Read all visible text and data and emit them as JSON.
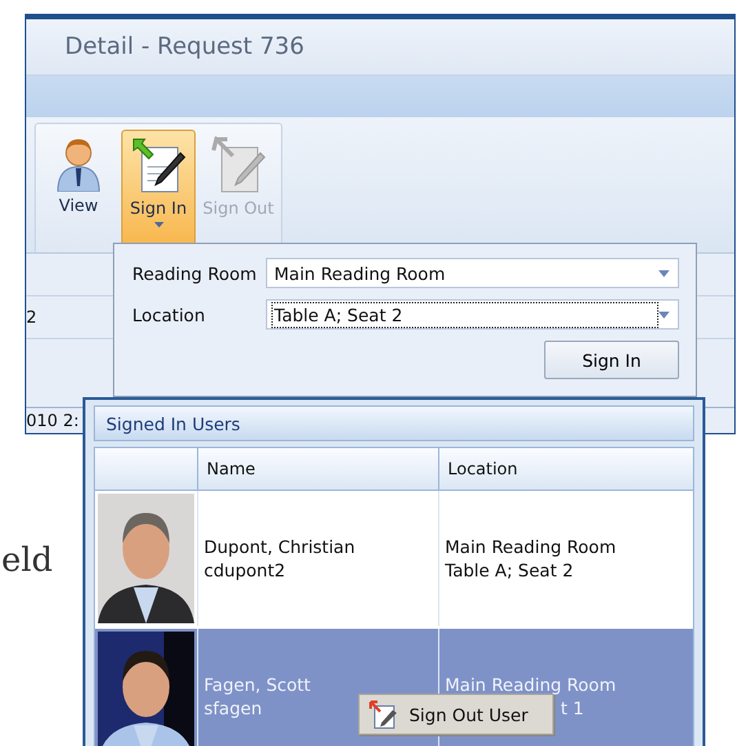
{
  "background_text": "eld",
  "window": {
    "title": "Detail - Request 736"
  },
  "ribbon": {
    "buttons": [
      {
        "kind": "view",
        "label": "View",
        "selected": false,
        "disabled": false,
        "has_menu": false
      },
      {
        "kind": "sign_in",
        "label": "Sign In",
        "selected": true,
        "disabled": false,
        "has_menu": true
      },
      {
        "kind": "sign_out",
        "label": "Sign Out",
        "selected": false,
        "disabled": true,
        "has_menu": false
      }
    ]
  },
  "form_rows": [
    "2",
    "010 2:"
  ],
  "sign_in_panel": {
    "fields": [
      {
        "label": "Reading Room",
        "value": "Main Reading Room",
        "focused": false
      },
      {
        "label": "Location",
        "value": "Table A; Seat 2",
        "focused": true
      }
    ],
    "button": "Sign In"
  },
  "users": {
    "title": "Signed In Users",
    "columns": [
      "Name",
      "Location"
    ],
    "rows": [
      {
        "selected": false,
        "name": "Dupont, Christian",
        "login": "cdupont2",
        "location": [
          {
            "text": "Main Reading Room",
            "covered": false
          },
          {
            "text": "Table A; Seat 2",
            "covered": false
          }
        ]
      },
      {
        "selected": true,
        "name": "Fagen, Scott",
        "login": "sfagen",
        "location": [
          {
            "text": "Main Reading Room",
            "covered": false
          },
          {
            "text": "t 1",
            "covered": true
          }
        ]
      }
    ]
  },
  "context_menu": {
    "items": [
      "Sign Out User"
    ]
  }
}
